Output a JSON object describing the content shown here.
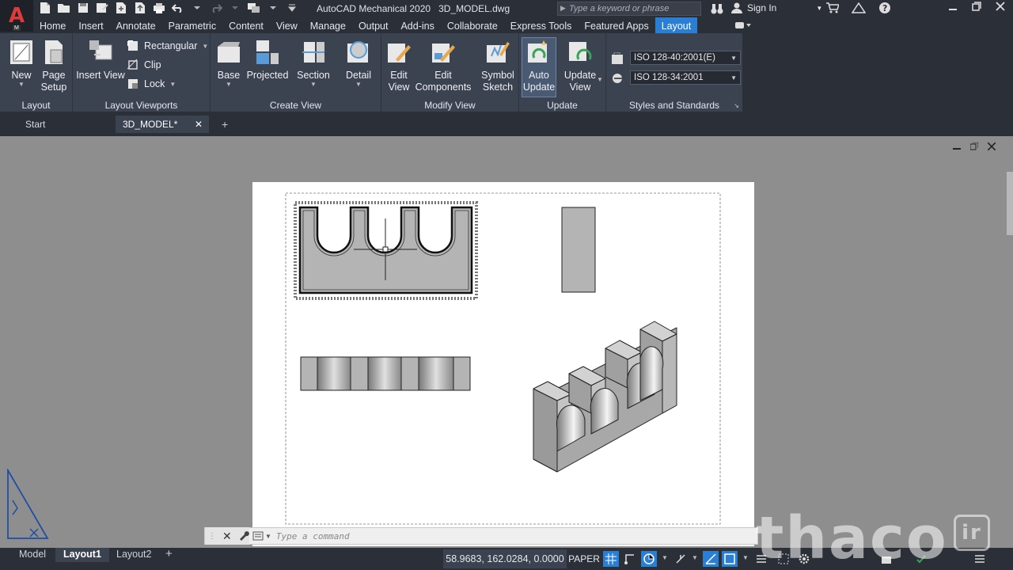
{
  "app": {
    "title": "AutoCAD Mechanical 2020",
    "file": "3D_MODEL.dwg",
    "logo_letter": "A",
    "logo_sub": "M"
  },
  "search": {
    "placeholder": "Type a keyword or phrase"
  },
  "account": {
    "sign_in": "Sign In"
  },
  "ribbon_tabs": [
    "Home",
    "Insert",
    "Annotate",
    "Parametric",
    "Content",
    "View",
    "Manage",
    "Output",
    "Add-ins",
    "Collaborate",
    "Express Tools",
    "Featured Apps",
    "Layout"
  ],
  "active_ribbon_tab": "Layout",
  "groups": {
    "layout": {
      "label": "Layout",
      "new": "New",
      "page_setup_1": "Page",
      "page_setup_2": "Setup"
    },
    "viewports": {
      "label": "Layout Viewports",
      "insert_view": "Insert View",
      "rectangular": "Rectangular",
      "clip": "Clip",
      "lock": "Lock"
    },
    "create_view": {
      "label": "Create View",
      "base": "Base",
      "projected": "Projected",
      "section": "Section",
      "detail": "Detail"
    },
    "modify_view": {
      "label": "Modify View",
      "edit_view_1": "Edit",
      "edit_view_2": "View",
      "edit_comp_1": "Edit",
      "edit_comp_2": "Components",
      "symbol_1": "Symbol",
      "symbol_2": "Sketch"
    },
    "update": {
      "label": "Update",
      "auto_1": "Auto",
      "auto_2": "Update",
      "update_view_1": "Update",
      "update_view_2": "View"
    },
    "styles": {
      "label": "Styles and Standards",
      "standard_1": "ISO 128-40:2001(E)",
      "standard_2": "ISO 128-34:2001"
    }
  },
  "doc_tabs": {
    "start": "Start",
    "active": "3D_MODEL*"
  },
  "command": {
    "placeholder": "Type a command"
  },
  "layout_tabs": {
    "model": "Model",
    "layout1": "Layout1",
    "layout2": "Layout2"
  },
  "status": {
    "coords": "58.9683, 162.0284, 0.0000",
    "space": "PAPER"
  },
  "watermark": {
    "text": "thaco",
    "badge": "ir"
  },
  "colors": {
    "accent": "#2a7fd4",
    "ribbon_bg": "#3b4250",
    "canvas_bg": "#8e8e8e",
    "paper": "#ffffff",
    "part_fill": "#b4b4b4"
  }
}
